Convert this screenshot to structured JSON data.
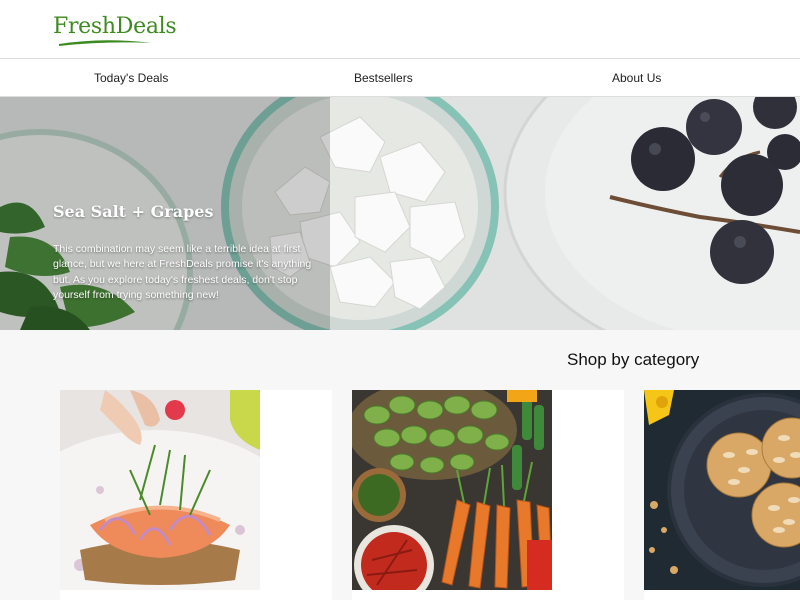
{
  "header": {
    "logo_text": "FreshDeals"
  },
  "nav": {
    "items": [
      "Today's Deals",
      "Bestsellers",
      "About Us"
    ]
  },
  "hero": {
    "title": "Sea Salt + Grapes",
    "body": "This combination may seem like a terrible idea at first glance, but we here at FreshDeals promise it's anything but. As you explore today's freshest deals, don't stop yourself from trying something new!"
  },
  "categories": {
    "heading": "Shop by category",
    "items": [
      {
        "image": "salmon-toast-photo"
      },
      {
        "image": "vegetable-market-photo"
      },
      {
        "image": "almond-cookies-photo"
      }
    ]
  },
  "colors": {
    "brand_green": "#3d8a1f",
    "page_bg": "#f7f7f7"
  }
}
